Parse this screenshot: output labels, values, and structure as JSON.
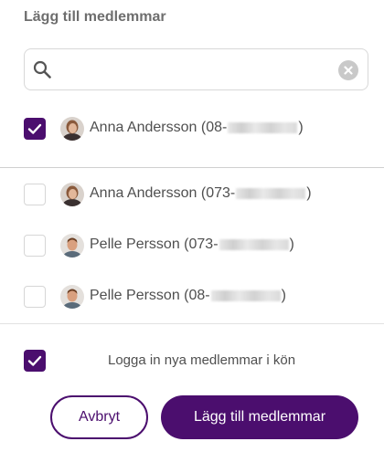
{
  "dialog": {
    "title": "Lägg till medlemmar"
  },
  "search": {
    "value": "",
    "placeholder": ""
  },
  "members": [
    {
      "name": "Anna Andersson",
      "phone_prefix": "(08-",
      "phone_suffix": ")",
      "checked": true
    },
    {
      "name": "Anna Andersson",
      "phone_prefix": "(073-",
      "phone_suffix": ")",
      "checked": false
    },
    {
      "name": "Pelle Persson",
      "phone_prefix": "(073-",
      "phone_suffix": ")",
      "checked": false
    },
    {
      "name": "Pelle Persson",
      "phone_prefix": "(08-",
      "phone_suffix": ")",
      "checked": false
    }
  ],
  "login_option": {
    "label": "Logga in nya medlemmar i kön",
    "checked": true
  },
  "buttons": {
    "cancel": "Avbryt",
    "add": "Lägg till medlemmar"
  },
  "colors": {
    "accent": "#4b0e6e",
    "checkbox_border": "#d6d6d6",
    "divider": "#e2e2e2"
  },
  "icons": {
    "search": "search-icon",
    "clear": "clear-icon",
    "check": "check-icon"
  }
}
